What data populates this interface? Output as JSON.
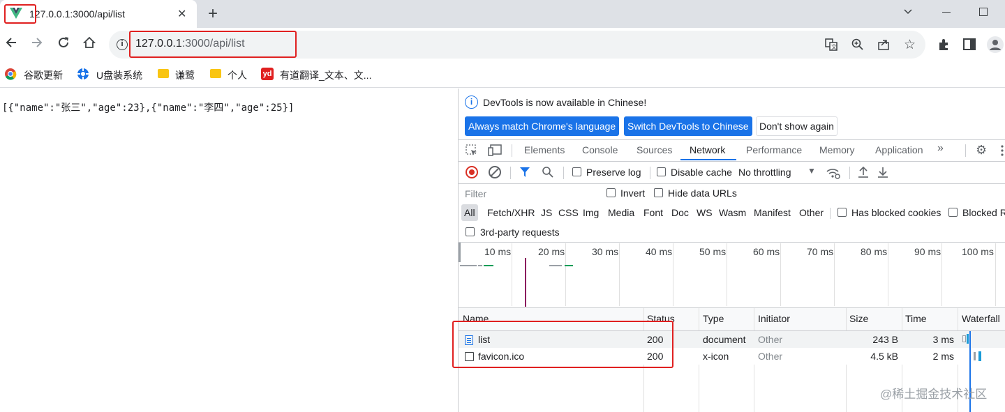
{
  "tab": {
    "title": "127.0.0.1:3000/api/list",
    "favicon": "vue-logo-icon"
  },
  "omnibox": {
    "host": "127.0.0.1",
    "path": ":3000/api/list"
  },
  "bookmarks": [
    {
      "label": "谷歌更新",
      "icon": "chrome-icon"
    },
    {
      "label": "U盘装系统",
      "icon": "gear-icon"
    },
    {
      "label": "谦鹭",
      "icon": "folder-icon"
    },
    {
      "label": "个人",
      "icon": "folder-icon"
    },
    {
      "label": "有道翻译_文本、文...",
      "icon": "youdao-icon"
    }
  ],
  "page": {
    "body_text": "[{\"name\":\"张三\",\"age\":23},{\"name\":\"李四\",\"age\":25}]"
  },
  "devtools": {
    "banner": {
      "text": "DevTools is now available in Chinese!",
      "btn_match": "Always match Chrome's language",
      "btn_switch": "Switch DevTools to Chinese",
      "btn_dont": "Don't show again"
    },
    "tabs": [
      "Elements",
      "Console",
      "Sources",
      "Network",
      "Performance",
      "Memory",
      "Application"
    ],
    "active_tab": "Network",
    "network_toolbar": {
      "preserve_log": "Preserve log",
      "disable_cache": "Disable cache",
      "throttling": "No throttling"
    },
    "filter": {
      "placeholder": "Filter",
      "invert": "Invert",
      "hide_data_urls": "Hide data URLs"
    },
    "types": [
      "All",
      "Fetch/XHR",
      "JS",
      "CSS",
      "Img",
      "Media",
      "Font",
      "Doc",
      "WS",
      "Wasm",
      "Manifest",
      "Other"
    ],
    "has_blocked_cookies": "Has blocked cookies",
    "blocked_requests": "Blocked R",
    "third_party": "3rd-party requests",
    "timeline_ticks": [
      "10 ms",
      "20 ms",
      "30 ms",
      "40 ms",
      "50 ms",
      "60 ms",
      "70 ms",
      "80 ms",
      "90 ms",
      "100 ms"
    ],
    "columns": [
      "Name",
      "Status",
      "Type",
      "Initiator",
      "Size",
      "Time",
      "Waterfall"
    ],
    "rows": [
      {
        "name": "list",
        "status": "200",
        "type": "document",
        "initiator": "Other",
        "size": "243 B",
        "time": "3 ms"
      },
      {
        "name": "favicon.ico",
        "status": "200",
        "type": "x-icon",
        "initiator": "Other",
        "size": "4.5 kB",
        "time": "2 ms"
      }
    ]
  },
  "watermark": "@稀土掘金技术社区",
  "colors": {
    "accent": "#1a73e8",
    "highlight": "#e02020"
  }
}
